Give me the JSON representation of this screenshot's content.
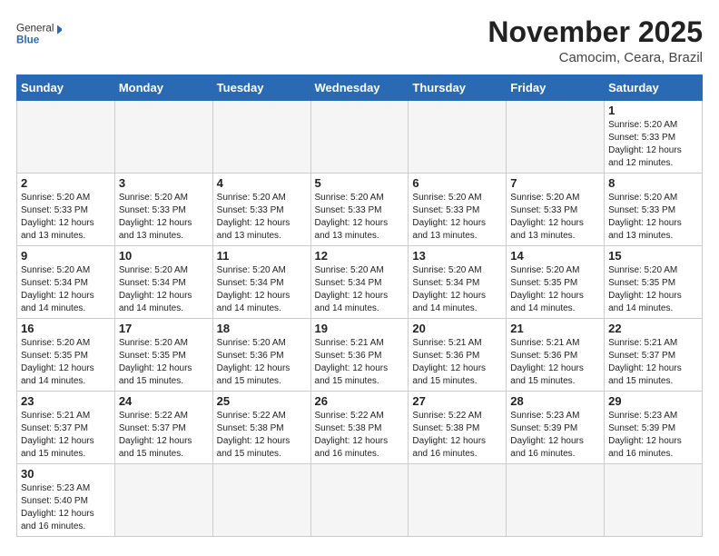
{
  "header": {
    "logo_general": "General",
    "logo_blue": "Blue",
    "title": "November 2025",
    "subtitle": "Camocim, Ceara, Brazil"
  },
  "weekdays": [
    "Sunday",
    "Monday",
    "Tuesday",
    "Wednesday",
    "Thursday",
    "Friday",
    "Saturday"
  ],
  "weeks": [
    [
      {
        "day": "",
        "info": ""
      },
      {
        "day": "",
        "info": ""
      },
      {
        "day": "",
        "info": ""
      },
      {
        "day": "",
        "info": ""
      },
      {
        "day": "",
        "info": ""
      },
      {
        "day": "",
        "info": ""
      },
      {
        "day": "1",
        "info": "Sunrise: 5:20 AM\nSunset: 5:33 PM\nDaylight: 12 hours and 12 minutes."
      }
    ],
    [
      {
        "day": "2",
        "info": "Sunrise: 5:20 AM\nSunset: 5:33 PM\nDaylight: 12 hours and 13 minutes."
      },
      {
        "day": "3",
        "info": "Sunrise: 5:20 AM\nSunset: 5:33 PM\nDaylight: 12 hours and 13 minutes."
      },
      {
        "day": "4",
        "info": "Sunrise: 5:20 AM\nSunset: 5:33 PM\nDaylight: 12 hours and 13 minutes."
      },
      {
        "day": "5",
        "info": "Sunrise: 5:20 AM\nSunset: 5:33 PM\nDaylight: 12 hours and 13 minutes."
      },
      {
        "day": "6",
        "info": "Sunrise: 5:20 AM\nSunset: 5:33 PM\nDaylight: 12 hours and 13 minutes."
      },
      {
        "day": "7",
        "info": "Sunrise: 5:20 AM\nSunset: 5:33 PM\nDaylight: 12 hours and 13 minutes."
      },
      {
        "day": "8",
        "info": "Sunrise: 5:20 AM\nSunset: 5:33 PM\nDaylight: 12 hours and 13 minutes."
      }
    ],
    [
      {
        "day": "9",
        "info": "Sunrise: 5:20 AM\nSunset: 5:34 PM\nDaylight: 12 hours and 14 minutes."
      },
      {
        "day": "10",
        "info": "Sunrise: 5:20 AM\nSunset: 5:34 PM\nDaylight: 12 hours and 14 minutes."
      },
      {
        "day": "11",
        "info": "Sunrise: 5:20 AM\nSunset: 5:34 PM\nDaylight: 12 hours and 14 minutes."
      },
      {
        "day": "12",
        "info": "Sunrise: 5:20 AM\nSunset: 5:34 PM\nDaylight: 12 hours and 14 minutes."
      },
      {
        "day": "13",
        "info": "Sunrise: 5:20 AM\nSunset: 5:34 PM\nDaylight: 12 hours and 14 minutes."
      },
      {
        "day": "14",
        "info": "Sunrise: 5:20 AM\nSunset: 5:35 PM\nDaylight: 12 hours and 14 minutes."
      },
      {
        "day": "15",
        "info": "Sunrise: 5:20 AM\nSunset: 5:35 PM\nDaylight: 12 hours and 14 minutes."
      }
    ],
    [
      {
        "day": "16",
        "info": "Sunrise: 5:20 AM\nSunset: 5:35 PM\nDaylight: 12 hours and 14 minutes."
      },
      {
        "day": "17",
        "info": "Sunrise: 5:20 AM\nSunset: 5:35 PM\nDaylight: 12 hours and 15 minutes."
      },
      {
        "day": "18",
        "info": "Sunrise: 5:20 AM\nSunset: 5:36 PM\nDaylight: 12 hours and 15 minutes."
      },
      {
        "day": "19",
        "info": "Sunrise: 5:21 AM\nSunset: 5:36 PM\nDaylight: 12 hours and 15 minutes."
      },
      {
        "day": "20",
        "info": "Sunrise: 5:21 AM\nSunset: 5:36 PM\nDaylight: 12 hours and 15 minutes."
      },
      {
        "day": "21",
        "info": "Sunrise: 5:21 AM\nSunset: 5:36 PM\nDaylight: 12 hours and 15 minutes."
      },
      {
        "day": "22",
        "info": "Sunrise: 5:21 AM\nSunset: 5:37 PM\nDaylight: 12 hours and 15 minutes."
      }
    ],
    [
      {
        "day": "23",
        "info": "Sunrise: 5:21 AM\nSunset: 5:37 PM\nDaylight: 12 hours and 15 minutes."
      },
      {
        "day": "24",
        "info": "Sunrise: 5:22 AM\nSunset: 5:37 PM\nDaylight: 12 hours and 15 minutes."
      },
      {
        "day": "25",
        "info": "Sunrise: 5:22 AM\nSunset: 5:38 PM\nDaylight: 12 hours and 15 minutes."
      },
      {
        "day": "26",
        "info": "Sunrise: 5:22 AM\nSunset: 5:38 PM\nDaylight: 12 hours and 16 minutes."
      },
      {
        "day": "27",
        "info": "Sunrise: 5:22 AM\nSunset: 5:38 PM\nDaylight: 12 hours and 16 minutes."
      },
      {
        "day": "28",
        "info": "Sunrise: 5:23 AM\nSunset: 5:39 PM\nDaylight: 12 hours and 16 minutes."
      },
      {
        "day": "29",
        "info": "Sunrise: 5:23 AM\nSunset: 5:39 PM\nDaylight: 12 hours and 16 minutes."
      }
    ],
    [
      {
        "day": "30",
        "info": "Sunrise: 5:23 AM\nSunset: 5:40 PM\nDaylight: 12 hours and 16 minutes."
      },
      {
        "day": "",
        "info": ""
      },
      {
        "day": "",
        "info": ""
      },
      {
        "day": "",
        "info": ""
      },
      {
        "day": "",
        "info": ""
      },
      {
        "day": "",
        "info": ""
      },
      {
        "day": "",
        "info": ""
      }
    ]
  ]
}
